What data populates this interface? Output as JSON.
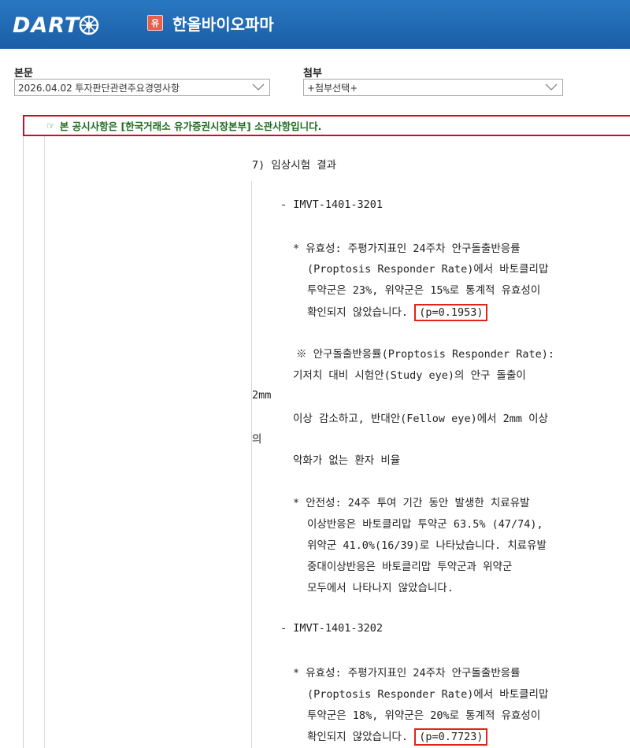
{
  "header": {
    "logo_text": "DART",
    "company_badge": "유",
    "company_name": "한올바이오파마"
  },
  "selectors": {
    "body_label": "본문",
    "body_value": "2026.04.02  투자판단관련주요경영사항",
    "attach_label": "첨부",
    "attach_value": "+첨부선택+"
  },
  "notice": {
    "icon": "hand-pointer-icon",
    "text": "본 공시사항은 [한국거래소 유가증권시장본부] 소관사항입니다."
  },
  "content": {
    "section_title": "7) 임상시험 결과",
    "trial1": {
      "name": "- IMVT-1401-3201",
      "efficacy_l1": "* 유효성: 주평가지표인 24주차 안구돌출반응률",
      "efficacy_l2": "(Proptosis Responder Rate)에서 바토클리맙",
      "efficacy_l3": "투약군은 23%, 위약군은 15%로 통계적 유효성이",
      "efficacy_l4": "확인되지 않았습니다.",
      "p_value": "(p=0.1953)",
      "note_l1": "※ 안구돌출반응률(Proptosis Responder Rate):",
      "note_l2": "기저치 대비 시험안(Study eye)의 안구 돌출이",
      "note_wrap1": "2mm",
      "note_l3": "이상 감소하고, 반대안(Fellow eye)에서 2mm 이상",
      "note_wrap2": "의",
      "note_l4": "악화가 없는 환자 비율",
      "safety_l1": "* 안전성: 24주 투여 기간 동안 발생한 치료유발",
      "safety_l2": "이상반응은 바토클리맙 투약군 63.5% (47/74),",
      "safety_l3": "위약군 41.0%(16/39)로 나타났습니다. 치료유발",
      "safety_l4": "중대이상반응은 바토클리맙 투약군과 위약군",
      "safety_l5": "모두에서 나타나지 않았습니다."
    },
    "trial2": {
      "name": "- IMVT-1401-3202",
      "efficacy_l1": "* 유효성: 주평가지표인 24주차 안구돌출반응률",
      "efficacy_l2": "(Proptosis Responder Rate)에서 바토클리맙",
      "efficacy_l3": "투약군은 18%, 위약군은 20%로 통계적 유효성이",
      "efficacy_l4": "확인되지 않았습니다.",
      "p_value": "(p=0.7723)"
    }
  }
}
